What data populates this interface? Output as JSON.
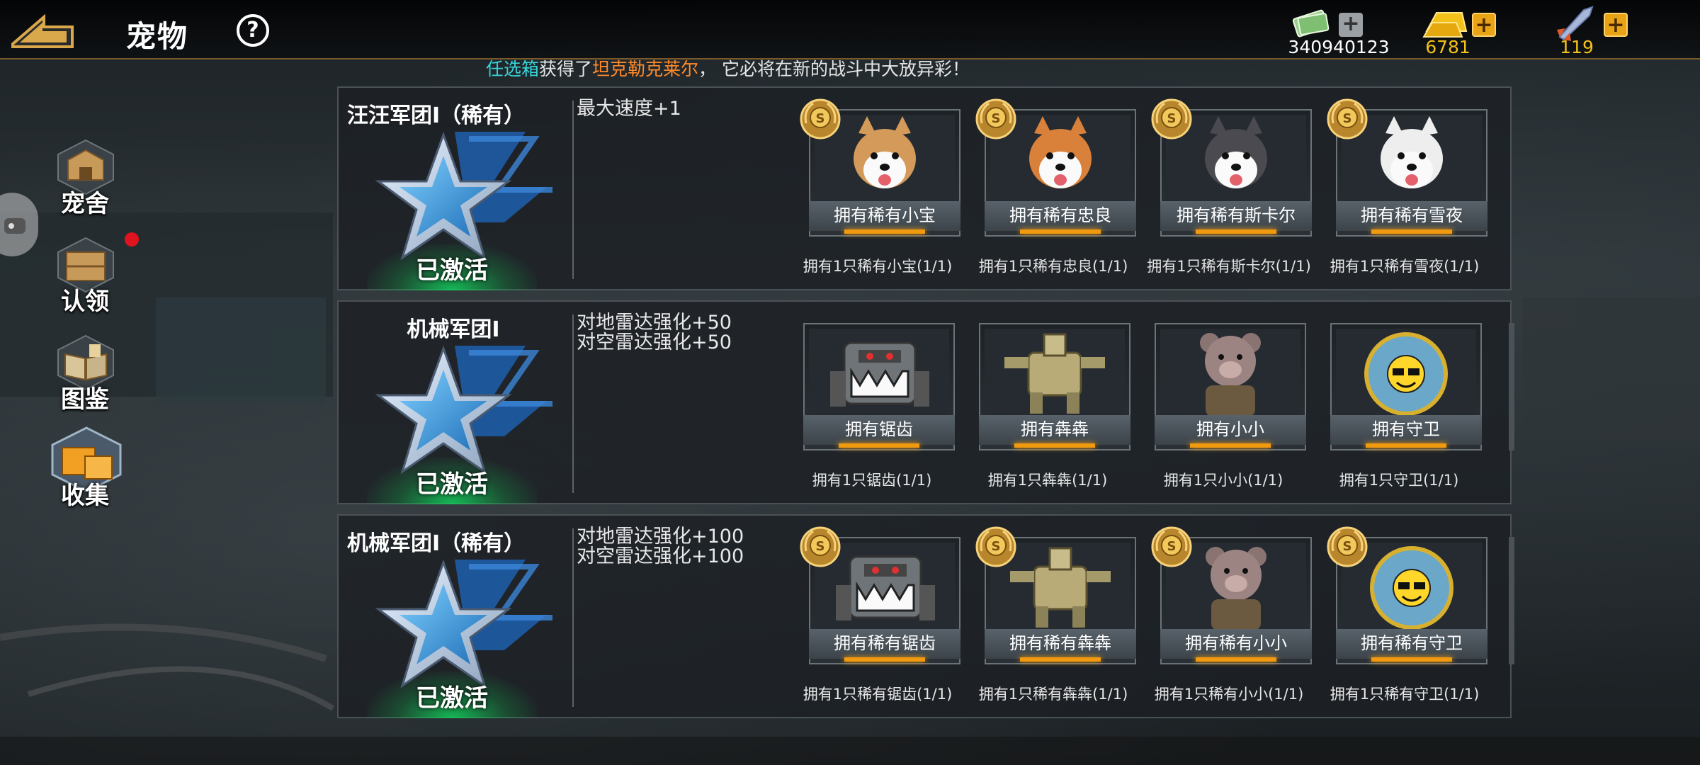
{
  "header": {
    "title": "宠物",
    "help_icon": "?"
  },
  "resources": [
    {
      "name": "cash",
      "value": "340940123",
      "icon": "cash-icon"
    },
    {
      "name": "gold",
      "value": "6781",
      "icon": "gold-bar-icon"
    },
    {
      "name": "rocket",
      "value": "119",
      "icon": "rocket-icon"
    }
  ],
  "ticker": {
    "part1": "任选箱",
    "part2": "获得了",
    "part3": "坦克勒克莱尔",
    "part4": "， 它必将在新的战斗中大放异彩！"
  },
  "nav": [
    {
      "label": "宠舍",
      "icon": "kennel-icon"
    },
    {
      "label": "认领",
      "icon": "crate-icon"
    },
    {
      "label": "图鉴",
      "icon": "book-icon"
    },
    {
      "label": "收集",
      "icon": "collection-box-icon"
    }
  ],
  "panels": [
    {
      "title": "汪汪军团Ⅰ（稀有）",
      "status": "已激活",
      "effects": [
        "最大速度+1"
      ],
      "cards": [
        {
          "name": "拥有稀有小宝",
          "cond": "拥有1只稀有小宝(1/1)",
          "art": "shiba-white-icon"
        },
        {
          "name": "拥有稀有忠良",
          "cond": "拥有1只稀有忠良(1/1)",
          "art": "shiba-orange-icon"
        },
        {
          "name": "拥有稀有斯卡尔",
          "cond": "拥有1只稀有斯卡尔(1/1)",
          "art": "husky-icon"
        },
        {
          "name": "拥有稀有雪夜",
          "cond": "拥有1只稀有雪夜(1/1)",
          "art": "white-dog-icon"
        }
      ]
    },
    {
      "title": "机械军团Ⅰ",
      "status": "已激活",
      "effects": [
        "对地雷达强化+50",
        "对空雷达强化+50"
      ],
      "cards": [
        {
          "name": "拥有锯齿",
          "cond": "拥有1只锯齿(1/1)",
          "art": "saw-mech-icon"
        },
        {
          "name": "拥有犇犇",
          "cond": "拥有1只犇犇(1/1)",
          "art": "bull-mech-icon"
        },
        {
          "name": "拥有小小",
          "cond": "拥有1只小小(1/1)",
          "art": "bear-mech-icon"
        },
        {
          "name": "拥有守卫",
          "cond": "拥有1只守卫(1/1)",
          "art": "guard-bot-icon"
        }
      ]
    },
    {
      "title": "机械军团Ⅰ（稀有）",
      "status": "已激活",
      "effects": [
        "对地雷达强化+100",
        "对空雷达强化+100"
      ],
      "cards": [
        {
          "name": "拥有稀有锯齿",
          "cond": "拥有1只稀有锯齿(1/1)",
          "art": "saw-mech-icon"
        },
        {
          "name": "拥有稀有犇犇",
          "cond": "拥有1只稀有犇犇(1/1)",
          "art": "bull-mech-icon"
        },
        {
          "name": "拥有稀有小小",
          "cond": "拥有1只稀有小小(1/1)",
          "art": "bear-mech-icon"
        },
        {
          "name": "拥有稀有守卫",
          "cond": "拥有1只稀有守卫(1/1)",
          "art": "guard-bot-icon"
        }
      ]
    }
  ],
  "colors": {
    "accent_orange": "#f19a10",
    "ticker_cyan": "#37d4d9",
    "ticker_orange": "#ff8a2a",
    "notify_red": "#e0141e"
  }
}
